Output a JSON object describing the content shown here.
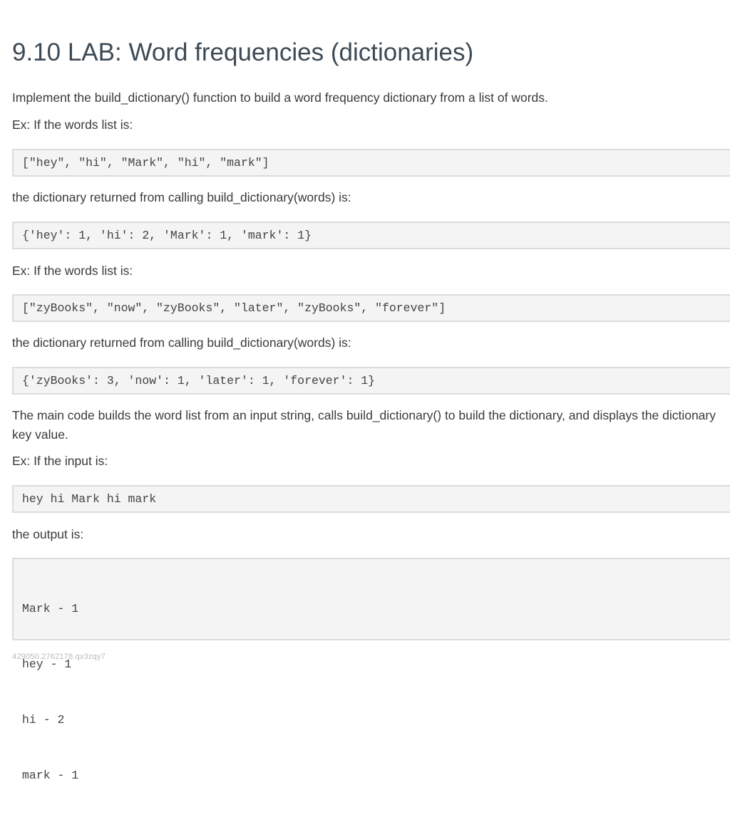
{
  "title": "9.10 LAB: Word frequencies (dictionaries)",
  "intro": "Implement the build_dictionary() function to build a word frequency dictionary from a list of words.",
  "ex1_label": "Ex: If the words list is:",
  "ex1_code": "[\"hey\", \"hi\", \"Mark\", \"hi\", \"mark\"]",
  "ex1_result_label": "the dictionary returned from calling build_dictionary(words) is:",
  "ex1_result_code": "{'hey': 1, 'hi': 2, 'Mark': 1, 'mark': 1}",
  "ex2_label": "Ex: If the words list is:",
  "ex2_code": "[\"zyBooks\", \"now\", \"zyBooks\", \"later\", \"zyBooks\", \"forever\"]",
  "ex2_result_label": "the dictionary returned from calling build_dictionary(words) is:",
  "ex2_result_code": "{'zyBooks': 3, 'now': 1, 'later': 1, 'forever': 1}",
  "main_description_line1": "The main code builds the word list from an input string, calls build_dictionary() to build the dictionary, and displays the dictionary",
  "main_description_line2": "key value.",
  "ex3_label": "Ex: If the input is:",
  "ex3_input": "hey hi Mark hi mark",
  "output_label": "the output is:",
  "output_lines": [
    "Mark - 1",
    "hey - 1",
    "hi - 2",
    "mark - 1"
  ],
  "footer_id": "429050.2762178.qx3zqy7"
}
